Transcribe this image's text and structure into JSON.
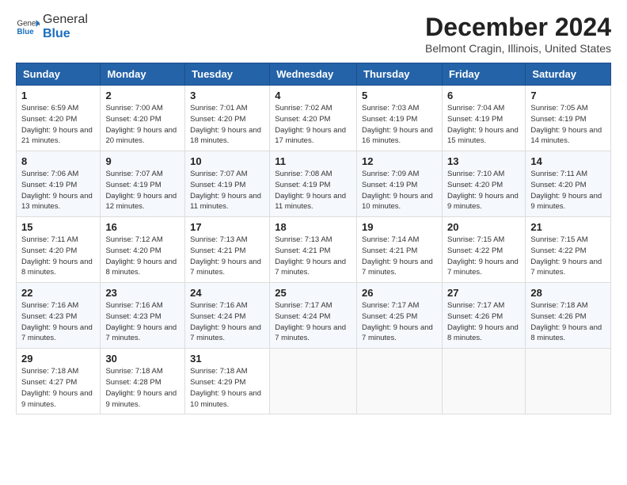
{
  "header": {
    "logo_general": "General",
    "logo_blue": "Blue",
    "month_title": "December 2024",
    "location": "Belmont Cragin, Illinois, United States"
  },
  "weekdays": [
    "Sunday",
    "Monday",
    "Tuesday",
    "Wednesday",
    "Thursday",
    "Friday",
    "Saturday"
  ],
  "weeks": [
    [
      {
        "day": "1",
        "sunrise": "Sunrise: 6:59 AM",
        "sunset": "Sunset: 4:20 PM",
        "daylight": "Daylight: 9 hours and 21 minutes."
      },
      {
        "day": "2",
        "sunrise": "Sunrise: 7:00 AM",
        "sunset": "Sunset: 4:20 PM",
        "daylight": "Daylight: 9 hours and 20 minutes."
      },
      {
        "day": "3",
        "sunrise": "Sunrise: 7:01 AM",
        "sunset": "Sunset: 4:20 PM",
        "daylight": "Daylight: 9 hours and 18 minutes."
      },
      {
        "day": "4",
        "sunrise": "Sunrise: 7:02 AM",
        "sunset": "Sunset: 4:20 PM",
        "daylight": "Daylight: 9 hours and 17 minutes."
      },
      {
        "day": "5",
        "sunrise": "Sunrise: 7:03 AM",
        "sunset": "Sunset: 4:19 PM",
        "daylight": "Daylight: 9 hours and 16 minutes."
      },
      {
        "day": "6",
        "sunrise": "Sunrise: 7:04 AM",
        "sunset": "Sunset: 4:19 PM",
        "daylight": "Daylight: 9 hours and 15 minutes."
      },
      {
        "day": "7",
        "sunrise": "Sunrise: 7:05 AM",
        "sunset": "Sunset: 4:19 PM",
        "daylight": "Daylight: 9 hours and 14 minutes."
      }
    ],
    [
      {
        "day": "8",
        "sunrise": "Sunrise: 7:06 AM",
        "sunset": "Sunset: 4:19 PM",
        "daylight": "Daylight: 9 hours and 13 minutes."
      },
      {
        "day": "9",
        "sunrise": "Sunrise: 7:07 AM",
        "sunset": "Sunset: 4:19 PM",
        "daylight": "Daylight: 9 hours and 12 minutes."
      },
      {
        "day": "10",
        "sunrise": "Sunrise: 7:07 AM",
        "sunset": "Sunset: 4:19 PM",
        "daylight": "Daylight: 9 hours and 11 minutes."
      },
      {
        "day": "11",
        "sunrise": "Sunrise: 7:08 AM",
        "sunset": "Sunset: 4:19 PM",
        "daylight": "Daylight: 9 hours and 11 minutes."
      },
      {
        "day": "12",
        "sunrise": "Sunrise: 7:09 AM",
        "sunset": "Sunset: 4:19 PM",
        "daylight": "Daylight: 9 hours and 10 minutes."
      },
      {
        "day": "13",
        "sunrise": "Sunrise: 7:10 AM",
        "sunset": "Sunset: 4:20 PM",
        "daylight": "Daylight: 9 hours and 9 minutes."
      },
      {
        "day": "14",
        "sunrise": "Sunrise: 7:11 AM",
        "sunset": "Sunset: 4:20 PM",
        "daylight": "Daylight: 9 hours and 9 minutes."
      }
    ],
    [
      {
        "day": "15",
        "sunrise": "Sunrise: 7:11 AM",
        "sunset": "Sunset: 4:20 PM",
        "daylight": "Daylight: 9 hours and 8 minutes."
      },
      {
        "day": "16",
        "sunrise": "Sunrise: 7:12 AM",
        "sunset": "Sunset: 4:20 PM",
        "daylight": "Daylight: 9 hours and 8 minutes."
      },
      {
        "day": "17",
        "sunrise": "Sunrise: 7:13 AM",
        "sunset": "Sunset: 4:21 PM",
        "daylight": "Daylight: 9 hours and 7 minutes."
      },
      {
        "day": "18",
        "sunrise": "Sunrise: 7:13 AM",
        "sunset": "Sunset: 4:21 PM",
        "daylight": "Daylight: 9 hours and 7 minutes."
      },
      {
        "day": "19",
        "sunrise": "Sunrise: 7:14 AM",
        "sunset": "Sunset: 4:21 PM",
        "daylight": "Daylight: 9 hours and 7 minutes."
      },
      {
        "day": "20",
        "sunrise": "Sunrise: 7:15 AM",
        "sunset": "Sunset: 4:22 PM",
        "daylight": "Daylight: 9 hours and 7 minutes."
      },
      {
        "day": "21",
        "sunrise": "Sunrise: 7:15 AM",
        "sunset": "Sunset: 4:22 PM",
        "daylight": "Daylight: 9 hours and 7 minutes."
      }
    ],
    [
      {
        "day": "22",
        "sunrise": "Sunrise: 7:16 AM",
        "sunset": "Sunset: 4:23 PM",
        "daylight": "Daylight: 9 hours and 7 minutes."
      },
      {
        "day": "23",
        "sunrise": "Sunrise: 7:16 AM",
        "sunset": "Sunset: 4:23 PM",
        "daylight": "Daylight: 9 hours and 7 minutes."
      },
      {
        "day": "24",
        "sunrise": "Sunrise: 7:16 AM",
        "sunset": "Sunset: 4:24 PM",
        "daylight": "Daylight: 9 hours and 7 minutes."
      },
      {
        "day": "25",
        "sunrise": "Sunrise: 7:17 AM",
        "sunset": "Sunset: 4:24 PM",
        "daylight": "Daylight: 9 hours and 7 minutes."
      },
      {
        "day": "26",
        "sunrise": "Sunrise: 7:17 AM",
        "sunset": "Sunset: 4:25 PM",
        "daylight": "Daylight: 9 hours and 7 minutes."
      },
      {
        "day": "27",
        "sunrise": "Sunrise: 7:17 AM",
        "sunset": "Sunset: 4:26 PM",
        "daylight": "Daylight: 9 hours and 8 minutes."
      },
      {
        "day": "28",
        "sunrise": "Sunrise: 7:18 AM",
        "sunset": "Sunset: 4:26 PM",
        "daylight": "Daylight: 9 hours and 8 minutes."
      }
    ],
    [
      {
        "day": "29",
        "sunrise": "Sunrise: 7:18 AM",
        "sunset": "Sunset: 4:27 PM",
        "daylight": "Daylight: 9 hours and 9 minutes."
      },
      {
        "day": "30",
        "sunrise": "Sunrise: 7:18 AM",
        "sunset": "Sunset: 4:28 PM",
        "daylight": "Daylight: 9 hours and 9 minutes."
      },
      {
        "day": "31",
        "sunrise": "Sunrise: 7:18 AM",
        "sunset": "Sunset: 4:29 PM",
        "daylight": "Daylight: 9 hours and 10 minutes."
      },
      null,
      null,
      null,
      null
    ]
  ]
}
